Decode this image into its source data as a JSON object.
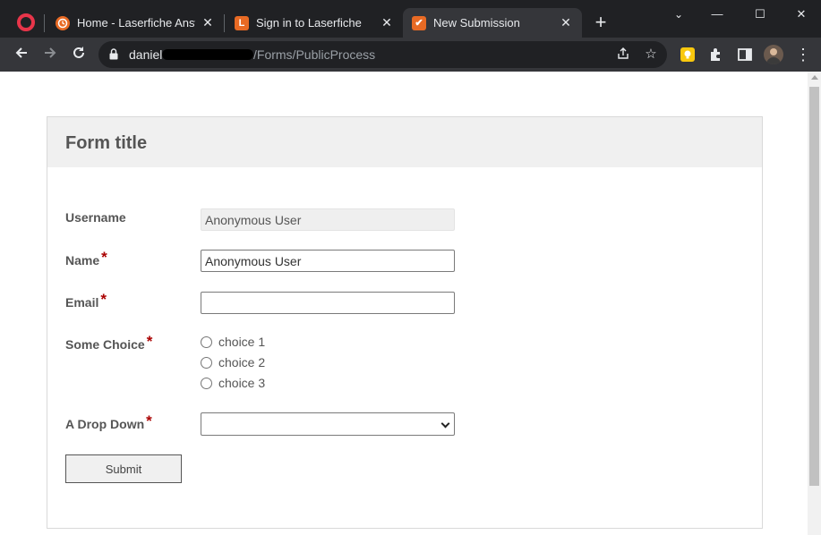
{
  "browser": {
    "tabs": [
      {
        "title": "Home - Laserfiche Answers",
        "favicon_letter": "",
        "favicon_color": "#e86a24",
        "active": false
      },
      {
        "title": "Sign in to Laserfiche",
        "favicon_letter": "L",
        "favicon_color": "#e86a24",
        "active": false
      },
      {
        "title": "New Submission",
        "favicon_letter": "✔",
        "favicon_color": "#e86a24",
        "active": true
      }
    ],
    "close_glyph": "✕",
    "new_tab_glyph": "+",
    "window_controls": {
      "minimize": "—",
      "maximize": "☐",
      "close": "✕",
      "dropdown": "⌄"
    },
    "url_host": "daniel",
    "url_path": "/Forms/PublicProcess",
    "accent_color": "#e8354a"
  },
  "form": {
    "title": "Form title",
    "fields": {
      "username": {
        "label": "Username",
        "value": "Anonymous User"
      },
      "name": {
        "label": "Name",
        "value": "Anonymous User",
        "required": "*"
      },
      "email": {
        "label": "Email",
        "value": "",
        "required": "*"
      },
      "choice": {
        "label": "Some Choice",
        "required": "*",
        "options": [
          "choice 1",
          "choice 2",
          "choice 3"
        ]
      },
      "dropdown": {
        "label": "A Drop Down",
        "required": "*",
        "selected": ""
      }
    },
    "submit_label": "Submit"
  }
}
